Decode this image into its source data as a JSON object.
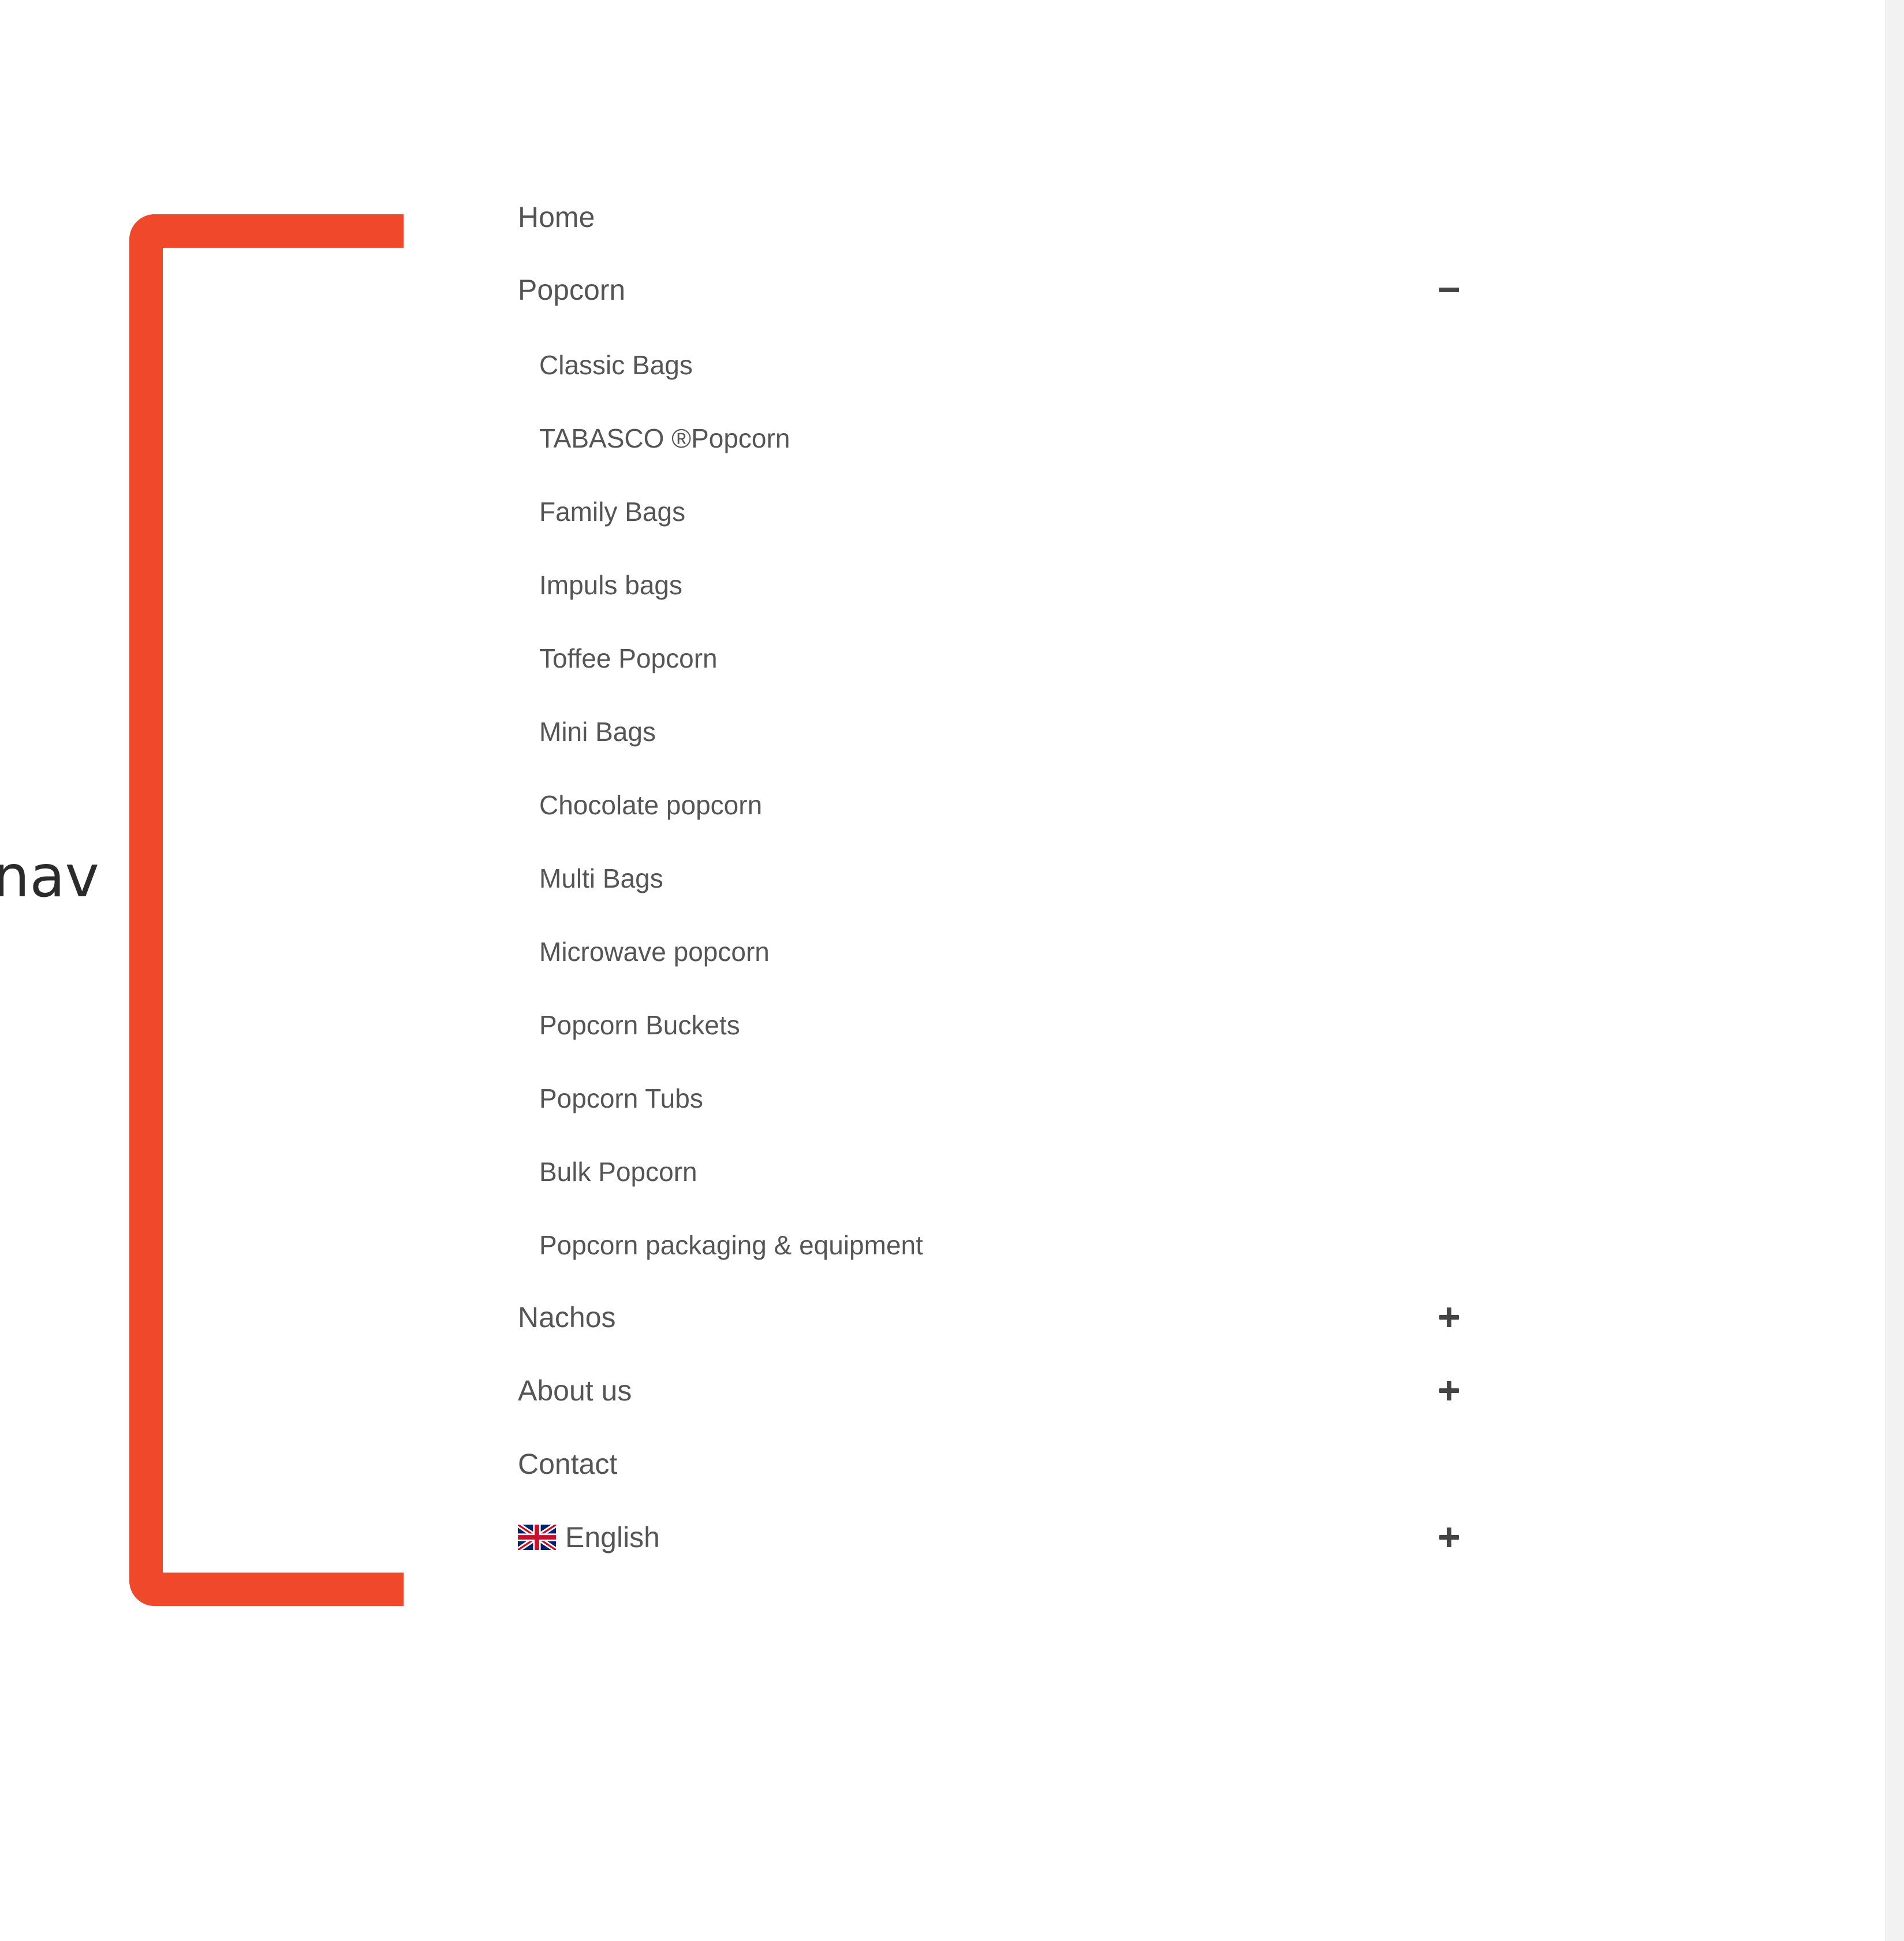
{
  "annotation": {
    "side_label": "nav",
    "bracket_color": "#f0482a"
  },
  "menu": {
    "items": [
      {
        "label": "Home"
      },
      {
        "label": "Popcorn",
        "toggle": "minus-icon",
        "expanded": true
      },
      {
        "label": "Nachos",
        "toggle": "plus-icon",
        "expanded": false
      },
      {
        "label": "About us",
        "toggle": "plus-icon",
        "expanded": false
      },
      {
        "label": "Contact"
      },
      {
        "label": "English",
        "icon": "uk-flag-icon",
        "toggle": "plus-icon",
        "expanded": false
      }
    ],
    "popcorn_submenu": [
      "Classic Bags",
      "TABASCO ®Popcorn",
      "Family Bags",
      "Impuls bags",
      "Toffee Popcorn",
      "Mini Bags",
      "Chocolate popcorn",
      "Multi Bags",
      "Microwave popcorn",
      "Popcorn Buckets",
      "Popcorn Tubs",
      "Bulk Popcorn",
      "Popcorn packaging & equipment"
    ]
  },
  "colors": {
    "text": "#555555",
    "toggle": "#444444",
    "accent": "#f0482a"
  }
}
